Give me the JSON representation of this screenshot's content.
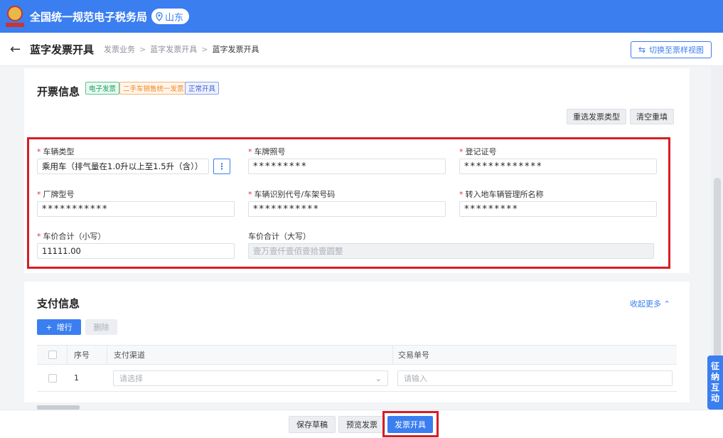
{
  "app": {
    "site_title": "全国统一规范电子税务局",
    "region": "山东"
  },
  "header": {
    "title": "蓝字发票开具",
    "breadcrumbs": [
      "发票业务",
      "蓝字发票开具",
      "蓝字发票开具"
    ],
    "switch_button": "切换至票样视图"
  },
  "invoice_info": {
    "title": "开票信息",
    "tags": [
      "电子发票",
      "二手车销售统一发票",
      "正常开具"
    ],
    "reselect_button": "重选发票类型",
    "clear_button": "清空重填",
    "fields": {
      "vehicle_type": {
        "label": "车辆类型",
        "value": "乘用车（排气量在1.0升以上至1.5升（含））"
      },
      "plate_number": {
        "label": "车牌照号",
        "value": "*********"
      },
      "registration_no": {
        "label": "登记证号",
        "value": "*************"
      },
      "model": {
        "label": "厂牌型号",
        "value": "***********"
      },
      "vin": {
        "label": "车辆识别代号/车架号码",
        "value": "***********"
      },
      "transfer_office": {
        "label": "转入地车辆管理所名称",
        "value": "*********"
      },
      "price_lower": {
        "label": "车价合计（小写）",
        "value": "11111.00"
      },
      "price_upper": {
        "label": "车价合计（大写）",
        "value": "壹万壹仟壹佰壹拾壹圆整"
      }
    }
  },
  "payment_info": {
    "title": "支付信息",
    "collapse_link": "收起更多",
    "add_row_button": "增行",
    "delete_button": "删除",
    "columns": [
      "序号",
      "支付渠道",
      "交易单号"
    ],
    "rows": [
      {
        "index": "1",
        "channel_placeholder": "请选择",
        "txn_placeholder": "请输入"
      }
    ]
  },
  "side_tab": {
    "label_chars": [
      "征",
      "纳",
      "互",
      "动"
    ]
  },
  "footer": {
    "save_draft": "保存草稿",
    "preview": "预览发票",
    "issue": "发票开具"
  },
  "colors": {
    "primary": "#3a7ef0",
    "highlight_frame": "#d71d24"
  }
}
